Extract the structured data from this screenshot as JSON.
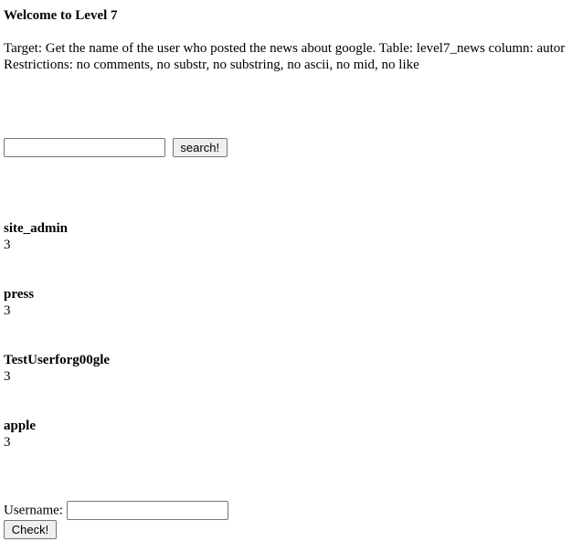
{
  "header": {
    "title": "Welcome to Level 7"
  },
  "description": {
    "target": "Target: Get the name of the user who posted the news about google. Table: level7_news column: autor",
    "restrictions": "Restrictions: no comments, no substr, no substring, no ascii, no mid, no like"
  },
  "search": {
    "input_value": "",
    "button_label": "search!"
  },
  "results": [
    {
      "name": "site_admin",
      "count": "3"
    },
    {
      "name": "press",
      "count": "3"
    },
    {
      "name": "TestUserforg00gle",
      "count": "3"
    },
    {
      "name": "apple",
      "count": "3"
    }
  ],
  "answer": {
    "username_label": "Username:",
    "username_value": "",
    "check_label": "Check!"
  }
}
